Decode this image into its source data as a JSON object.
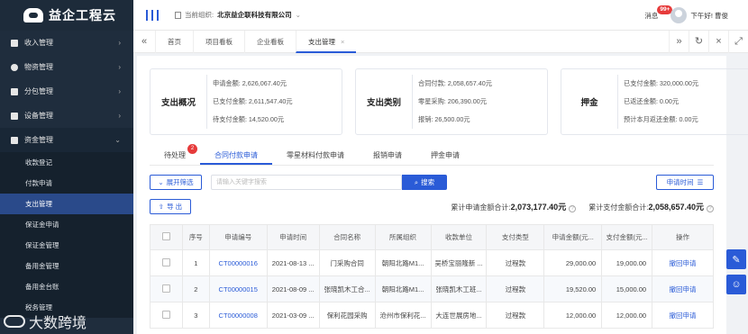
{
  "sidebar": {
    "logo": "益企工程云",
    "items": [
      {
        "label": "收入管理"
      },
      {
        "label": "物资管理"
      },
      {
        "label": "分包管理"
      },
      {
        "label": "设备管理"
      },
      {
        "label": "资金管理"
      }
    ],
    "sub_items": [
      {
        "label": "收款登记"
      },
      {
        "label": "付款申请"
      },
      {
        "label": "支出管理"
      },
      {
        "label": "保证金申请"
      },
      {
        "label": "保证金管理"
      },
      {
        "label": "备用金管理"
      },
      {
        "label": "备用金台账"
      },
      {
        "label": "税务管理"
      }
    ]
  },
  "header": {
    "org_label": "当前组织:",
    "org_name": "北京益企联科技有限公司",
    "msg_label": "消息",
    "msg_badge": "99+",
    "greeting": "下午好! 曹俊"
  },
  "tabs": [
    {
      "label": "首页"
    },
    {
      "label": "项目看板"
    },
    {
      "label": "企业看板"
    },
    {
      "label": "支出管理"
    }
  ],
  "cards": [
    {
      "title": "支出概况",
      "lines": [
        "申请金额: 2,626,067.40元",
        "已支付金额: 2,611,547.40元",
        "待支付金额: 14,520.00元"
      ]
    },
    {
      "title": "支出类别",
      "lines": [
        "合同付款: 2,058,657.40元",
        "零星采购: 206,390.00元",
        "报销: 26,500.00元"
      ]
    },
    {
      "title": "押金",
      "lines": [
        "已支付金额: 320,000.00元",
        "已返还金额: 0.00元",
        "预计本月返还金额: 0.00元"
      ]
    }
  ],
  "content_tabs": [
    {
      "label": "待处理",
      "badge": "2"
    },
    {
      "label": "合同付款申请"
    },
    {
      "label": "零星材料付款申请"
    },
    {
      "label": "报销申请"
    },
    {
      "label": "押金申请"
    }
  ],
  "toolbar": {
    "filter": "展开筛选",
    "search_placeholder": "请输入关键字搜索",
    "search": "搜索",
    "date": "申请时间",
    "export": "导 出"
  },
  "totals": {
    "apply_label": "累计申请金额合计:",
    "apply_value": "2,073,177.40元",
    "paid_label": "累计支付金额合计:",
    "paid_value": "2,058,657.40元"
  },
  "table": {
    "headers": [
      "",
      "序号",
      "申请编号",
      "申请时间",
      "合同名称",
      "所属组织",
      "收款单位",
      "支付类型",
      "申请金额(元...",
      "支付金额(元...",
      "操作"
    ],
    "rows": [
      [
        "",
        "1",
        "CT00000016",
        "2021-08-13 ...",
        "门采购合同",
        "朝阳北路M1...",
        "吴桥宝丽隆新 ...",
        "过程款",
        "29,000.00",
        "19,000.00",
        "撤回申请"
      ],
      [
        "",
        "2",
        "CT00000015",
        "2021-08-09 ...",
        "张晓凯木工合...",
        "朝阳北路M1...",
        "张晓凯木工班...",
        "过程款",
        "19,520.00",
        "15,000.00",
        "撤回申请"
      ],
      [
        "",
        "3",
        "CT00000008",
        "2021-03-09 ...",
        "保利花园采购",
        "沧州市保利花...",
        "大连世展房地...",
        "过程款",
        "12,000.00",
        "12,000.00",
        "撤回申请"
      ]
    ]
  },
  "watermark": "大数跨境"
}
